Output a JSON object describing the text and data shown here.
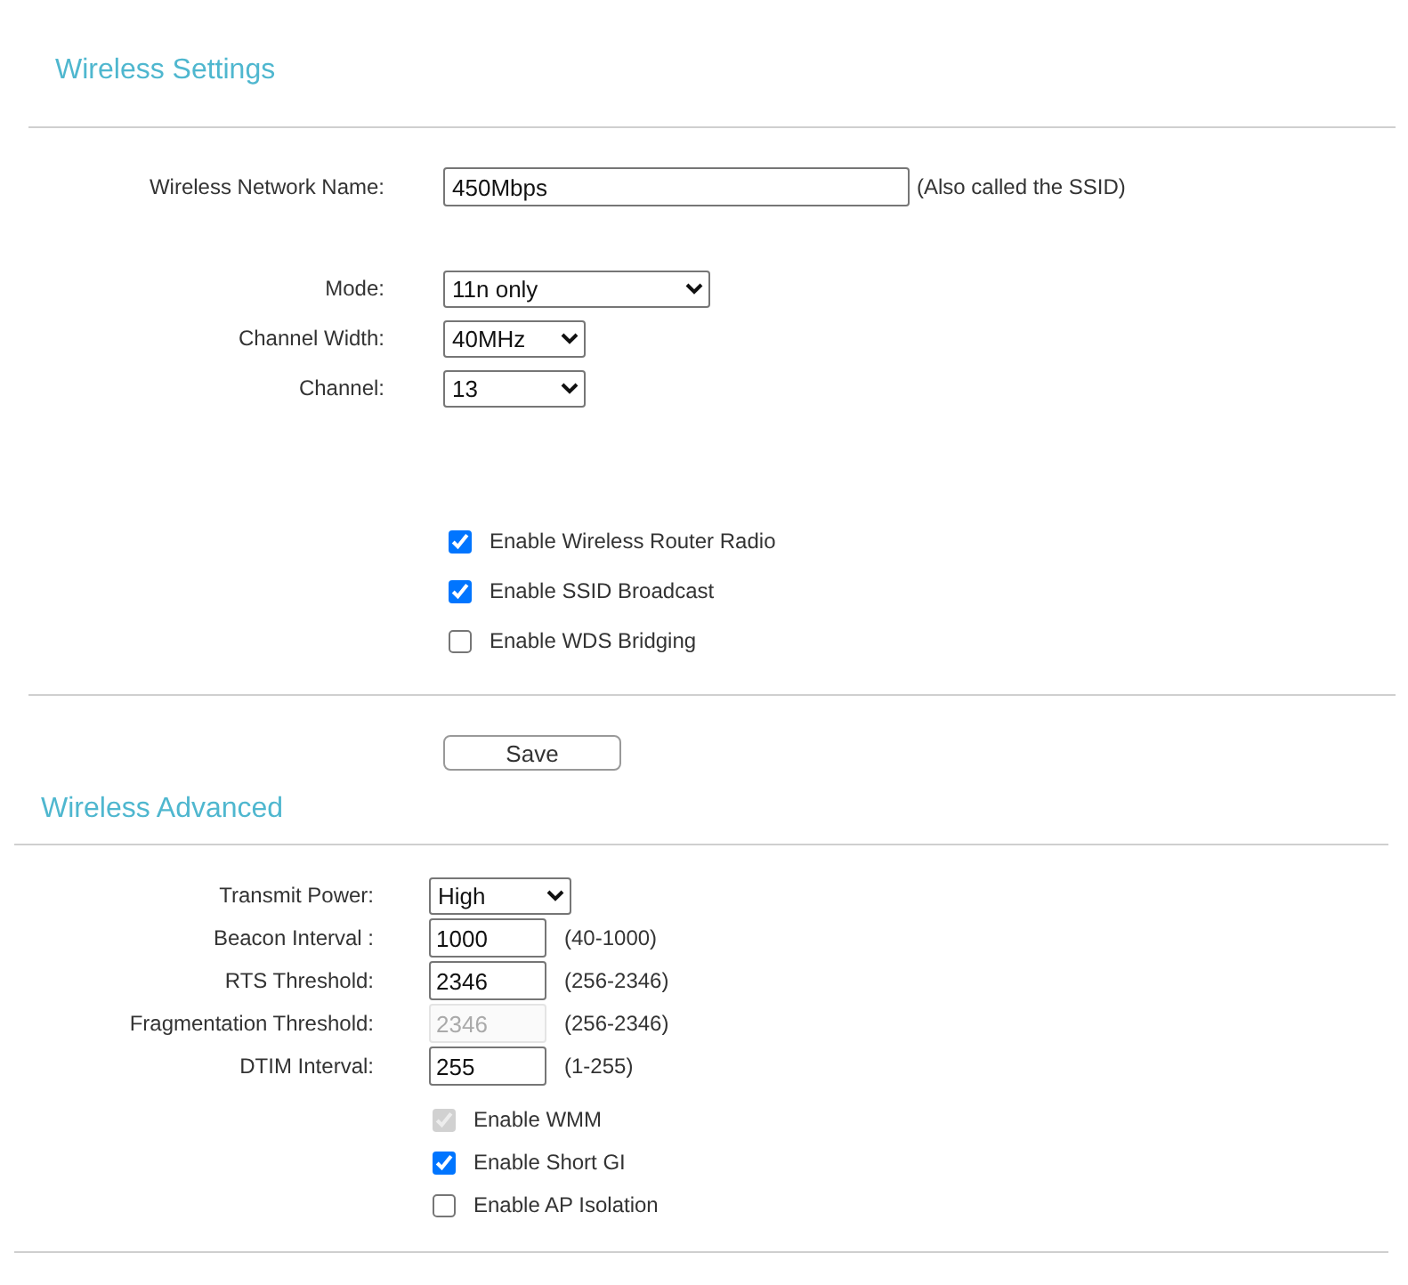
{
  "wireless_settings": {
    "title": "Wireless Settings",
    "network_name": {
      "label": "Wireless Network Name:",
      "value": "450Mbps",
      "hint": "(Also called the SSID)"
    },
    "radio": [
      {
        "kind": "wide",
        "label": "Mode:",
        "value": "11n only"
      },
      {
        "kind": "narrow",
        "label": "Channel Width:",
        "value": "40MHz"
      },
      {
        "kind": "narrow",
        "label": "Channel:",
        "value": "13"
      }
    ],
    "options": [
      {
        "label": "Enable Wireless Router Radio",
        "checked": true,
        "disabled": false
      },
      {
        "label": "Enable SSID Broadcast",
        "checked": true,
        "disabled": false
      },
      {
        "label": "Enable WDS Bridging",
        "checked": false,
        "disabled": false
      }
    ],
    "save_button": "Save"
  },
  "wireless_advanced": {
    "title": "Wireless Advanced",
    "fields": [
      {
        "kind": "select",
        "label": "Transmit Power:",
        "value": "High",
        "disabled": false
      },
      {
        "kind": "input",
        "label": "Beacon Interval :",
        "value": "1000",
        "range": "(40-1000)",
        "disabled": false
      },
      {
        "kind": "input",
        "label": "RTS Threshold:",
        "value": "2346",
        "range": "(256-2346)",
        "disabled": false
      },
      {
        "kind": "input",
        "label": "Fragmentation Threshold:",
        "value": "2346",
        "range": "(256-2346)",
        "disabled": true
      },
      {
        "kind": "input",
        "label": "DTIM Interval:",
        "value": "255",
        "range": "(1-255)",
        "disabled": false
      }
    ],
    "options": [
      {
        "label": "Enable WMM",
        "checked": true,
        "disabled": true
      },
      {
        "label": "Enable Short GI",
        "checked": true,
        "disabled": false
      },
      {
        "label": "Enable AP Isolation",
        "checked": false,
        "disabled": false
      }
    ]
  }
}
